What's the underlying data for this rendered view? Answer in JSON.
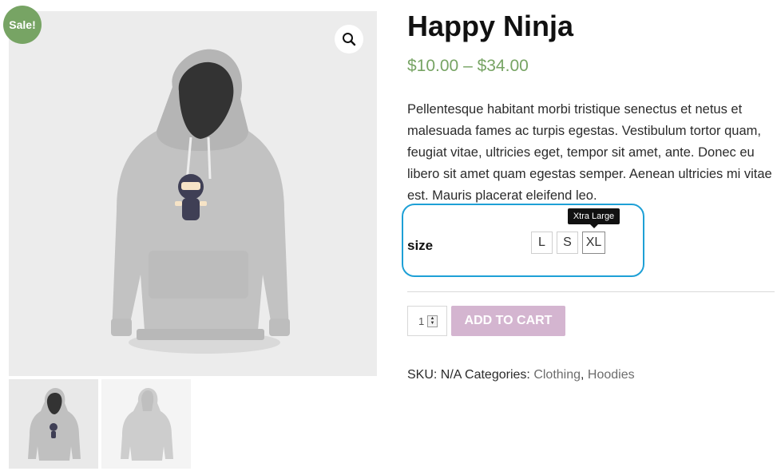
{
  "badge": {
    "sale_label": "Sale!"
  },
  "gallery": {
    "zoom_icon": "magnifier-icon",
    "main_image": "hoodie-front-ninja-logo",
    "thumbnails": [
      "hoodie-front-ninja-logo",
      "hoodie-back"
    ]
  },
  "product": {
    "title": "Happy Ninja",
    "price_range": "$10.00 – $34.00",
    "description": "Pellentesque habitant morbi tristique senectus et netus et malesuada fames ac turpis egestas. Vestibulum tortor quam, feugiat vitae, ultricies eget, tempor sit amet, ante. Donec eu libero sit amet quam egestas semper. Aenean ultricies mi vitae est. Mauris placerat eleifend leo."
  },
  "variation": {
    "label": "size",
    "options": [
      "L",
      "S",
      "XL"
    ],
    "tooltip": "Xtra Large"
  },
  "cart": {
    "quantity": "1",
    "add_to_cart_label": "ADD TO CART"
  },
  "meta": {
    "sku_text": "SKU: N/A",
    "categories_label": "Categories:",
    "categories": [
      "Clothing",
      "Hoodies"
    ],
    "separator": ","
  },
  "colors": {
    "sale_badge": "#77a464",
    "price": "#77a464",
    "add_to_cart_bg": "#d4b5d0",
    "highlight_outline": "#1ea0d6",
    "tooltip_bg": "#111111"
  }
}
